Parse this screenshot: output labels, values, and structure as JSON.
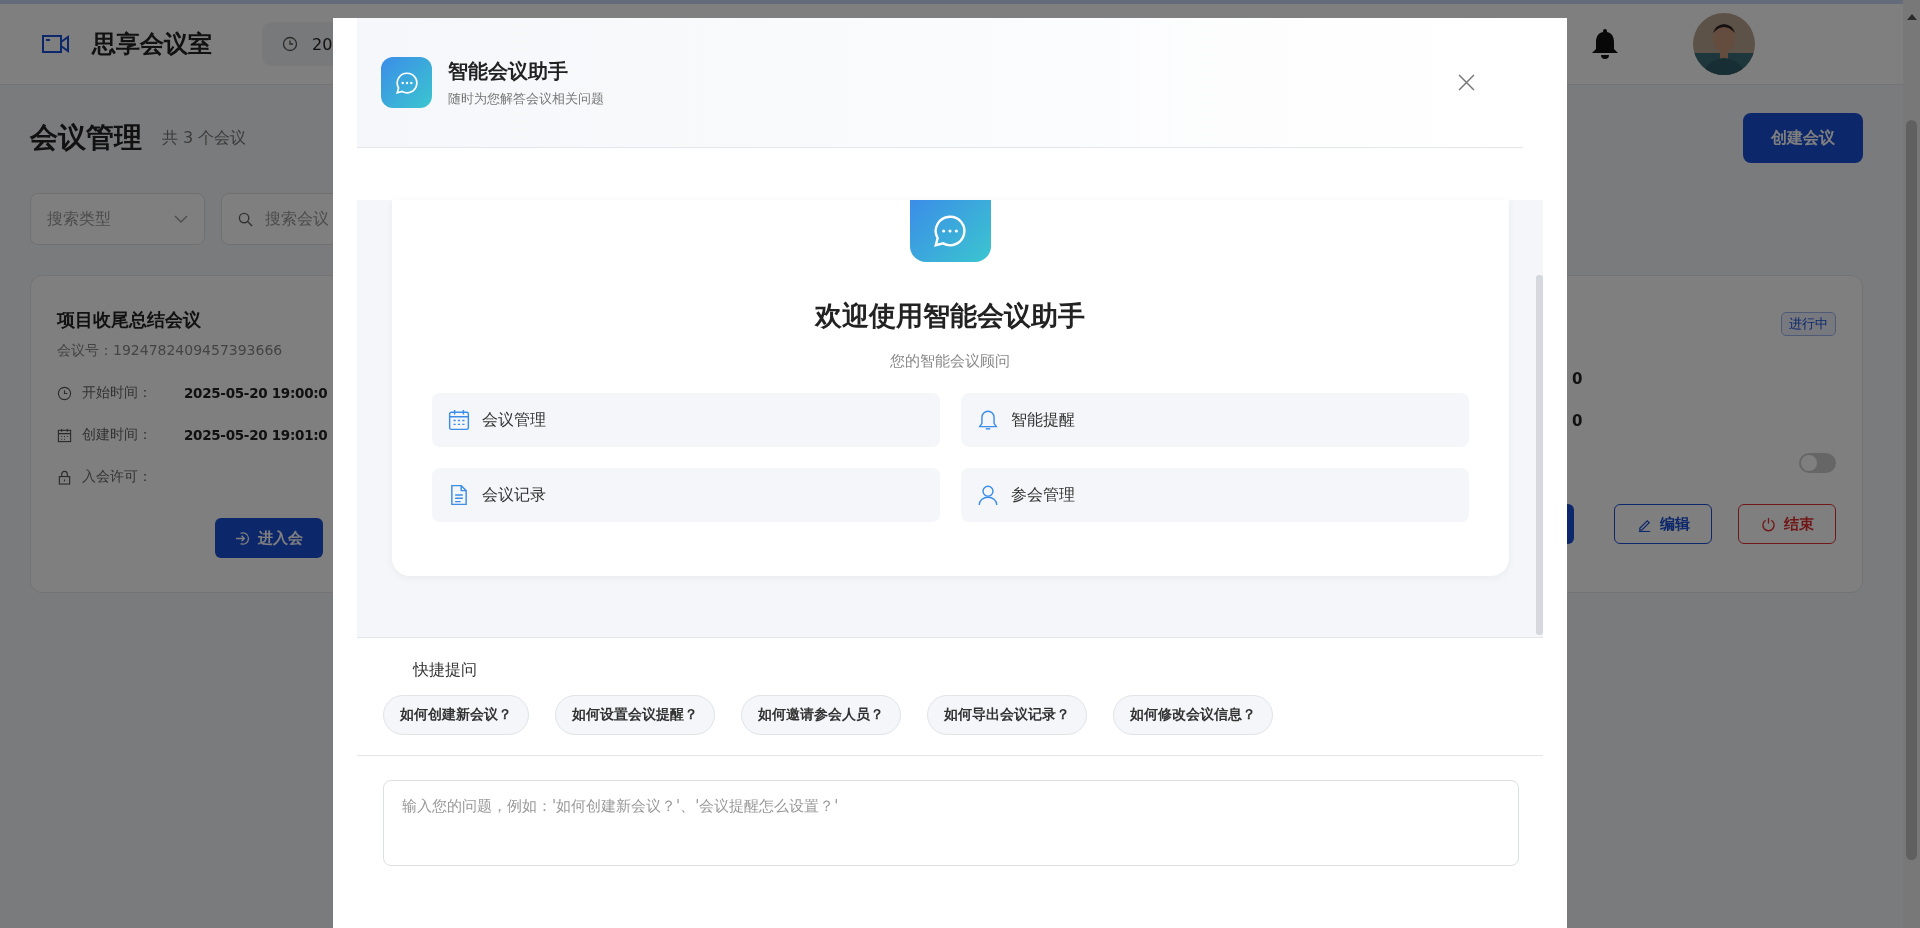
{
  "header": {
    "app_title": "思享会议室",
    "date_partial": "20"
  },
  "page": {
    "title": "会议管理",
    "count": "共 3 个会议",
    "create_button": "创建会议",
    "filters": {
      "type_placeholder": "搜索类型",
      "search_placeholder": "搜索会议"
    },
    "card": {
      "title": "项目收尾总结会议",
      "meeting_id": "会议号：1924782409457393666",
      "status": "进行中",
      "fields": [
        {
          "kind": "clock",
          "label": "开始时间：",
          "value": "2025-05-20 19:00:0"
        },
        {
          "kind": "calendar",
          "label": "创建时间：",
          "value": "2025-05-20 19:01:0"
        },
        {
          "kind": "lock",
          "label": "入会许可："
        }
      ],
      "right_values": [
        "0",
        "0"
      ],
      "permission_on": false,
      "left_button": "进入会",
      "right_buttons": [
        {
          "kind": "primary"
        },
        {
          "kind": "edit",
          "label": "编辑"
        },
        {
          "kind": "end",
          "label": "结束"
        }
      ]
    }
  },
  "modal": {
    "title": "智能会议助手",
    "subtitle": "随时为您解答会议相关问题",
    "welcome": {
      "heading": "欢迎使用智能会议助手",
      "subtitle": "您的智能会议顾问",
      "features": [
        {
          "kind": "calendar",
          "label": "会议管理"
        },
        {
          "kind": "bell",
          "label": "智能提醒"
        },
        {
          "kind": "document",
          "label": "会议记录"
        },
        {
          "kind": "user",
          "label": "参会管理"
        }
      ]
    },
    "quick": {
      "label": "快捷提问",
      "questions": [
        "如何创建新会议？",
        "如何设置会议提醒？",
        "如何邀请参会人员？",
        "如何导出会议记录？",
        "如何修改会议信息？"
      ]
    },
    "input": {
      "placeholder": "输入您的问题，例如：'如何创建新会议？'、'会议提醒怎么设置？'"
    }
  }
}
